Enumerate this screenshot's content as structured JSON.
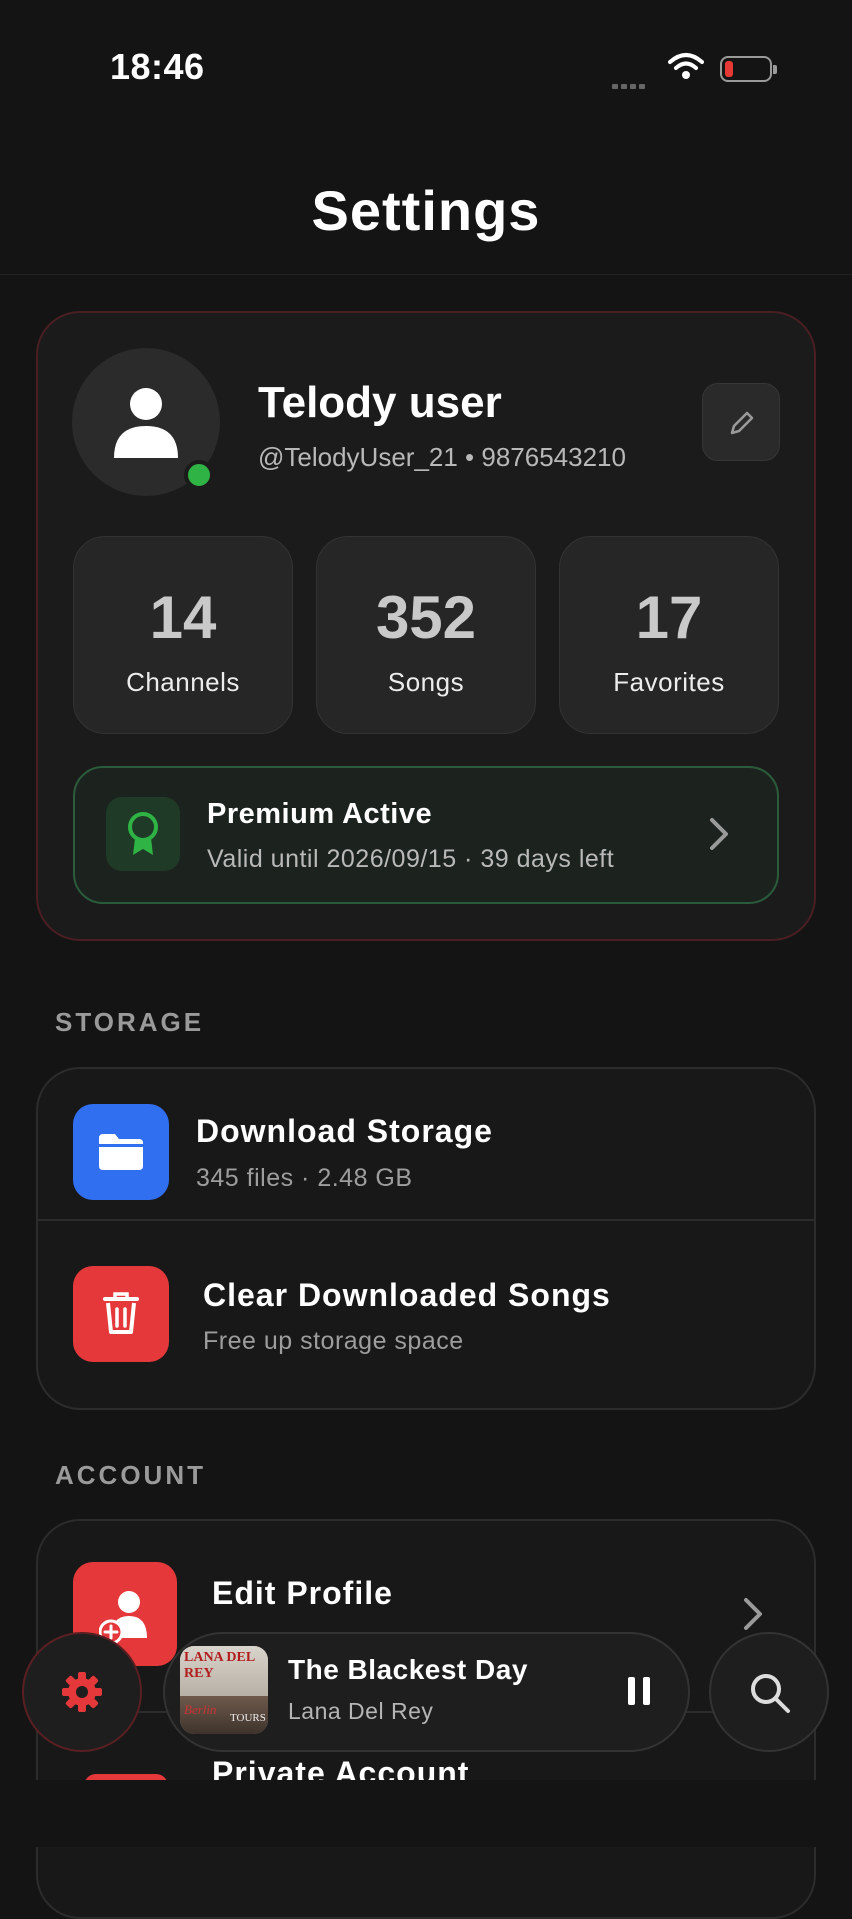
{
  "status_bar": {
    "time": "18:46"
  },
  "header": {
    "title": "Settings"
  },
  "profile": {
    "name": "Telody user",
    "handle_phone": "@TelodyUser_21 • 9876543210",
    "stats": [
      {
        "value": "14",
        "label": "Channels"
      },
      {
        "value": "352",
        "label": "Songs"
      },
      {
        "value": "17",
        "label": "Favorites"
      }
    ],
    "premium": {
      "title": "Premium Active",
      "subtitle": "Valid until 2026/09/15 · 39 days left"
    }
  },
  "storage": {
    "section_label": "STORAGE",
    "items": [
      {
        "title": "Download Storage",
        "subtitle": "345 files · 2.48 GB",
        "icon": "folder-icon",
        "color": "#2f6ff0"
      },
      {
        "title": "Clear Downloaded Songs",
        "subtitle": "Free up storage space",
        "icon": "trash-icon",
        "color": "#e5383b"
      }
    ]
  },
  "account": {
    "section_label": "ACCOUNT",
    "items": [
      {
        "title": "Edit Profile",
        "icon": "add-user-icon",
        "color": "#e5383b"
      },
      {
        "title": "Private Account",
        "icon": "lock-icon",
        "color": "#e5383b"
      }
    ]
  },
  "now_playing": {
    "title": "The Blackest Day",
    "artist": "Lana Del Rey",
    "album_art_text": [
      "LANA DEL REY",
      "Berlin",
      "TOURS"
    ]
  },
  "colors": {
    "background": "#141414",
    "accent_red": "#e5383b",
    "premium_green": "#2fb344",
    "online": "#2fb344"
  }
}
